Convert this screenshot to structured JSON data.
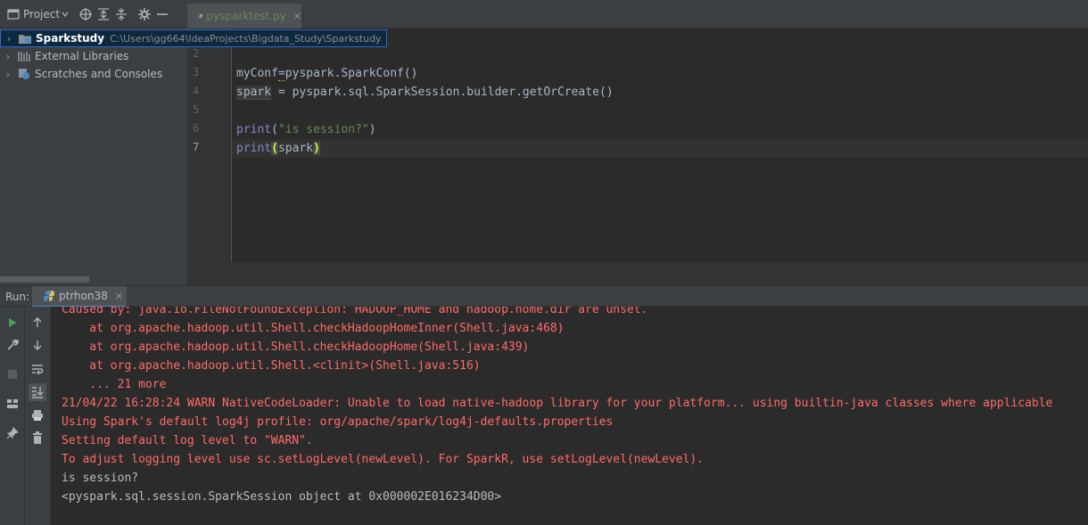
{
  "project_panel": {
    "title": "Project",
    "tree": [
      {
        "name": "Sparkstudy",
        "path": "C:\\Users\\gg664\\IdeaProjects\\Bigdata_Study\\Sparkstudy"
      },
      {
        "name": "External Libraries"
      },
      {
        "name": "Scratches and Consoles"
      }
    ]
  },
  "editor": {
    "tab_label": "pysparktest.py",
    "line_numbers": [
      "2",
      "3",
      "4",
      "5",
      "6",
      "7"
    ],
    "lines": {
      "l3": {
        "a": "myConf",
        "b": "=",
        "c": "pyspark.SparkConf()"
      },
      "l4": {
        "a": "spark",
        "b": " = pyspark.sql.SparkSession.builder.getOrCreate()"
      },
      "l6": {
        "fn": "print",
        "open": "(",
        "str": "\"is session?\"",
        "close": ")"
      },
      "l7": {
        "fn": "print",
        "open": "(",
        "arg": "spark",
        "close": ")"
      }
    }
  },
  "run_panel": {
    "label": "Run:",
    "tab_label": "ptrhon38",
    "console_lines": [
      {
        "text": "Caused by: java.io.FileNotFoundException: HADOOP_HOME and hadoop.home.dir are unset.",
        "kind": "err"
      },
      {
        "text": "    at org.apache.hadoop.util.Shell.checkHadoopHomeInner(Shell.java:468)",
        "kind": "err"
      },
      {
        "text": "    at org.apache.hadoop.util.Shell.checkHadoopHome(Shell.java:439)",
        "kind": "err"
      },
      {
        "text": "    at org.apache.hadoop.util.Shell.<clinit>(Shell.java:516)",
        "kind": "err"
      },
      {
        "text": "    ... 21 more",
        "kind": "err"
      },
      {
        "text": "21/04/22 16:28:24 WARN NativeCodeLoader: Unable to load native-hadoop library for your platform... using builtin-java classes where applicable",
        "kind": "err"
      },
      {
        "text": "Using Spark's default log4j profile: org/apache/spark/log4j-defaults.properties",
        "kind": "err"
      },
      {
        "text": "Setting default log level to \"WARN\".",
        "kind": "err"
      },
      {
        "text": "To adjust logging level use sc.setLogLevel(newLevel). For SparkR, use setLogLevel(newLevel).",
        "kind": "err"
      },
      {
        "text": "is session?",
        "kind": "out"
      },
      {
        "text": "<pyspark.sql.session.SparkSession object at 0x000002E016234D00>",
        "kind": "out"
      }
    ]
  },
  "icons": {
    "toolbar": [
      "folder-icon",
      "crosshair-icon",
      "expand-all-icon",
      "collapse-all-icon",
      "gear-icon",
      "minimize-icon"
    ],
    "run_side": [
      "run-icon",
      "wrench-icon",
      "stop-icon",
      "layout-icon",
      "pin-icon"
    ],
    "run_side2": [
      "up-arrow-icon",
      "down-arrow-icon",
      "soft-wrap-icon",
      "scroll-to-end-icon",
      "print-icon",
      "trash-icon"
    ]
  },
  "colors": {
    "error_text": "#ff6b68",
    "string": "#6a8759",
    "builtin": "#8888c6",
    "accent": "#4a88c7"
  }
}
